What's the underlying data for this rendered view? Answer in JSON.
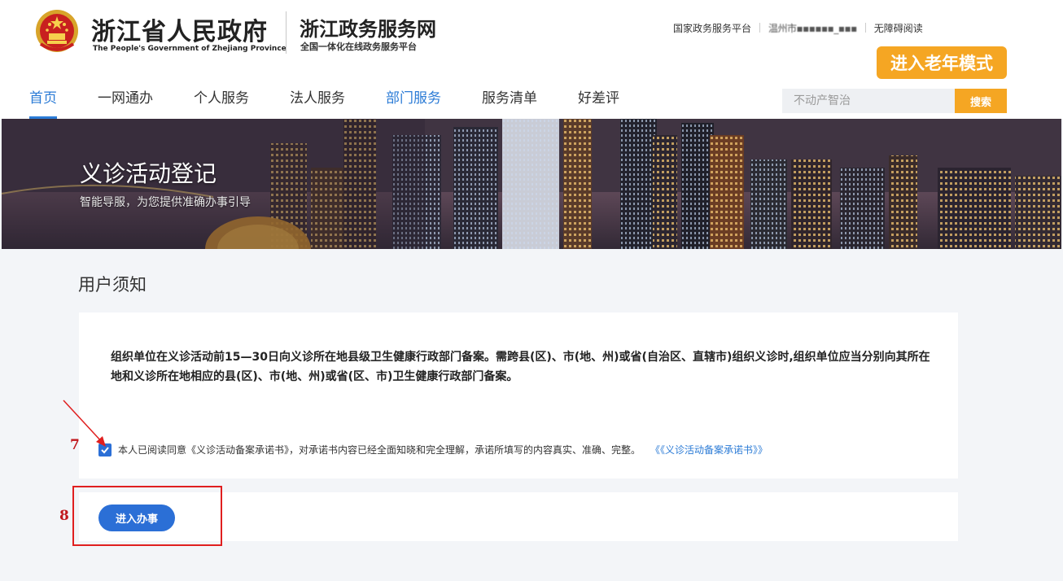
{
  "header": {
    "gov_title": "浙江省人民政府",
    "gov_subtitle": "The People's Government of Zhejiang Province",
    "site_title": "浙江政务服务网",
    "site_subtitle": "全国一体化在线政务服务平台",
    "top_links": [
      "国家政务服务平台",
      "温州市▪▪▪▪▪▪_▪▪▪",
      "无障碍阅读"
    ],
    "elder_mode_label": "进入老年模式"
  },
  "nav": {
    "items": [
      "首页",
      "一网通办",
      "个人服务",
      "法人服务",
      "部门服务",
      "服务清单",
      "好差评"
    ],
    "active": "首页"
  },
  "search": {
    "placeholder": "不动产智治",
    "button_label": "搜索"
  },
  "banner": {
    "title": "义诊活动登记",
    "subtitle": "智能导服，为您提供准确办事引导"
  },
  "notice": {
    "section_title": "用户须知",
    "text": "组织单位在义诊活动前15—30日向义诊所在地县级卫生健康行政部门备案。需跨县(区)、市(地、州)或省(自治区、直辖市)组织义诊时,组织单位应当分别向其所在地和义诊所在地相应的县(区)、市(地、州)或省(区、市)卫生健康行政部门备案。",
    "agree_checked": true,
    "agree_text": "本人已阅读同意《义诊活动备案承诺书》，对承诺书内容已经全面知晓和完全理解，承诺所填写的内容真实、准确、完整。",
    "agree_link": "《《义诊活动备案承诺书》》"
  },
  "actions": {
    "proceed_label": "进入办事"
  },
  "annotations": {
    "step7": "7",
    "step8": "8"
  },
  "colors": {
    "accent_blue": "#2b7bd6",
    "accent_orange": "#f5a623",
    "annotation_red": "#e01f1f"
  }
}
